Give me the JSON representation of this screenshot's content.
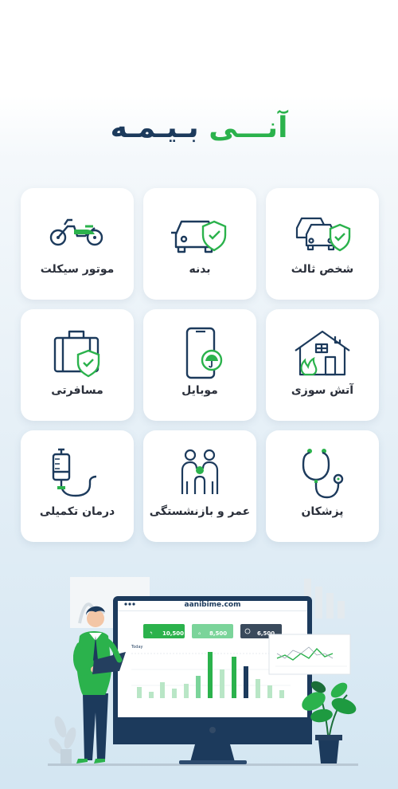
{
  "brand": {
    "word_first": "آنـــی",
    "word_second": "بـیـمـه"
  },
  "services": [
    {
      "label": "شخص ثالث",
      "icon": "car-shield-icon"
    },
    {
      "label": "بدنه",
      "icon": "car-insurance-icon"
    },
    {
      "label": "موتور سیکلت",
      "icon": "motorcycle-icon"
    },
    {
      "label": "آتش سوزی",
      "icon": "house-fire-icon"
    },
    {
      "label": "موبایل",
      "icon": "mobile-umbrella-icon"
    },
    {
      "label": "مسافرتی",
      "icon": "suitcase-shield-icon"
    },
    {
      "label": "پزشکان",
      "icon": "stethoscope-icon"
    },
    {
      "label": "عمر و بازنشستگی",
      "icon": "family-icon"
    },
    {
      "label": "درمان تکمیلی",
      "icon": "iv-drip-icon"
    }
  ],
  "hero": {
    "url": "aanibime.com",
    "stat_1": "10,500",
    "stat_2": "8,500",
    "stat_3": "6,500",
    "stat_caption": "Today",
    "accent": "#2bb24c",
    "dark": "#1c3a5c"
  }
}
